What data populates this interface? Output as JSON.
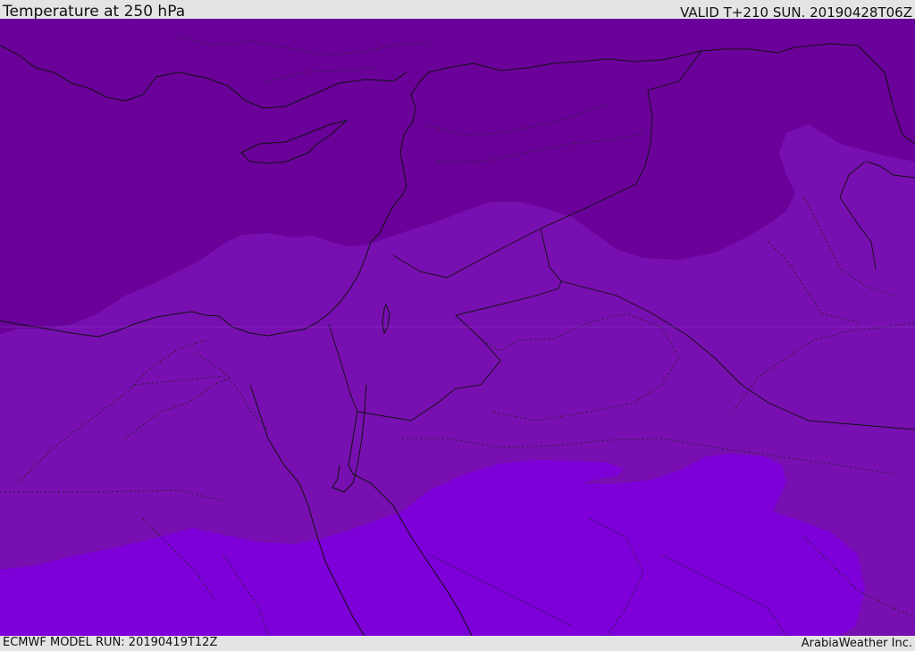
{
  "header": {
    "title": "Temperature at 250 hPa",
    "valid_time": "VALID T+210 SUN. 20190428T06Z"
  },
  "footer": {
    "model_run": "ECMWF MODEL RUN: 20190419T12Z",
    "credit": "ArabiaWeather Inc."
  },
  "colors": {
    "band_cold": "#6a0299",
    "band_mid": "#780fb0",
    "band_warm": "#7d00d8"
  }
}
